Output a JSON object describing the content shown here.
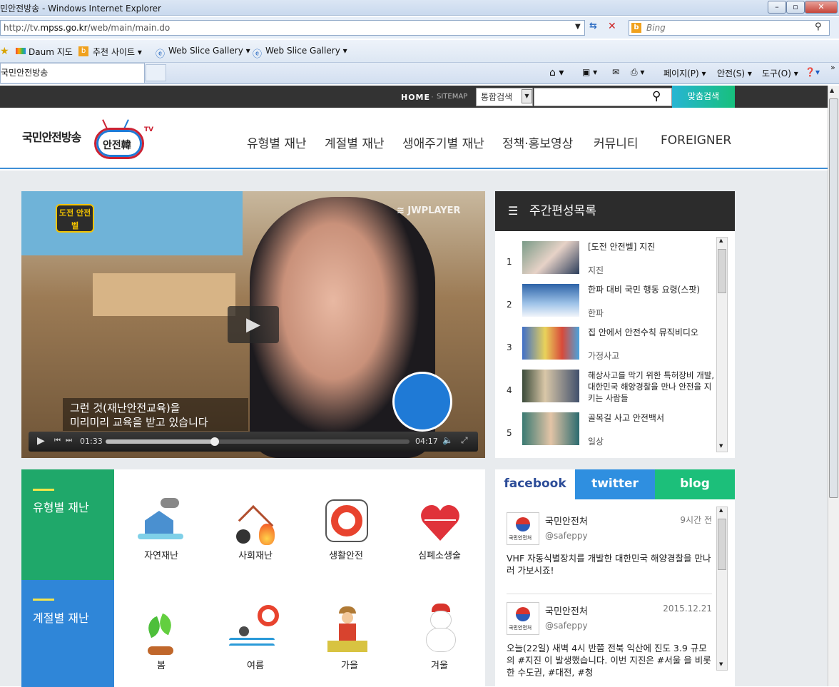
{
  "browser": {
    "title": "민안전방송 - Windows Internet Explorer",
    "url_prefix": "http://tv.",
    "url_domain": "mpss.go.kr",
    "url_path": "/web/main/main.do",
    "search_placeholder": "Bing",
    "favorites": [
      "Daum 지도",
      "추천 사이트",
      "Web Slice Gallery",
      "Web Slice Gallery"
    ],
    "tab_label": "국민안전방송",
    "commands": [
      "페이지(P)",
      "안전(S)",
      "도구(O)"
    ]
  },
  "site": {
    "top_links": {
      "home": "HOME",
      "sitemap": "SITEMAP"
    },
    "search_select": "통합검색",
    "search_button": "맞춤검색",
    "logo_text": "국민안전방송",
    "logo_badge": "안전韓",
    "logo_tv": "TV",
    "nav": [
      "유형별 재난",
      "계절별 재난",
      "생애주기별 재난",
      "정책·홍보영상",
      "커뮤니티",
      "FOREIGNER"
    ]
  },
  "video": {
    "brand": "JWPLAYER",
    "show_logo": "도전 안전벨",
    "subtitle_line1": "그런 것(재난안전교육)을",
    "subtitle_line2": "미리미리 교육을 받고 있습니다",
    "current_time": "01:33",
    "duration": "04:17",
    "progress": 0.36
  },
  "schedule": {
    "title": "주간편성목록",
    "items": [
      {
        "num": "1",
        "title": "[도전 안전벨] 지진",
        "category": "지진"
      },
      {
        "num": "2",
        "title": "한파 대비 국민 행동 요령(스팟)",
        "category": "한파"
      },
      {
        "num": "3",
        "title": "집 안에서 안전수칙 뮤직비디오",
        "category": "가정사고"
      },
      {
        "num": "4",
        "title": "해상사고를 막기 위한 특허장비 개발, 대한민국 해양경찰을 만나 안전을 지키는 사람들",
        "category": ""
      },
      {
        "num": "5",
        "title": "골목길 사고 안전백서",
        "category": "일상"
      }
    ]
  },
  "categories": {
    "type_label": "유형별 재난",
    "season_label": "계절별 재난",
    "types": [
      "자연재난",
      "사회재난",
      "생활안전",
      "심폐소생술"
    ],
    "seasons": [
      "봄",
      "여름",
      "가을",
      "겨울"
    ]
  },
  "social": {
    "tabs": [
      "facebook",
      "twitter",
      "blog"
    ],
    "posts": [
      {
        "name": "국민안전처",
        "handle": "@safeppy",
        "time": "9시간 전",
        "text": "VHF 자동식별장치를 개발한 대한민국 해양경찰을 만나러 가보시죠!"
      },
      {
        "name": "국민안전처",
        "handle": "@safeppy",
        "time": "2015.12.21",
        "text": "오늘(22일) 새벽 4시 반쯤 전북 익산에 진도 3.9 규모의 #지진 이 발생했습니다. 이번 지진은 #서울 을 비롯한 수도권, #대전, #청"
      }
    ]
  },
  "colors": {
    "accent": "#3e8fd6",
    "type_green": "#1fa86a",
    "season_blue": "#2f86d8",
    "facebook": "#ffffff",
    "twitter": "#2f8fe0",
    "blog": "#1cbf7a"
  }
}
